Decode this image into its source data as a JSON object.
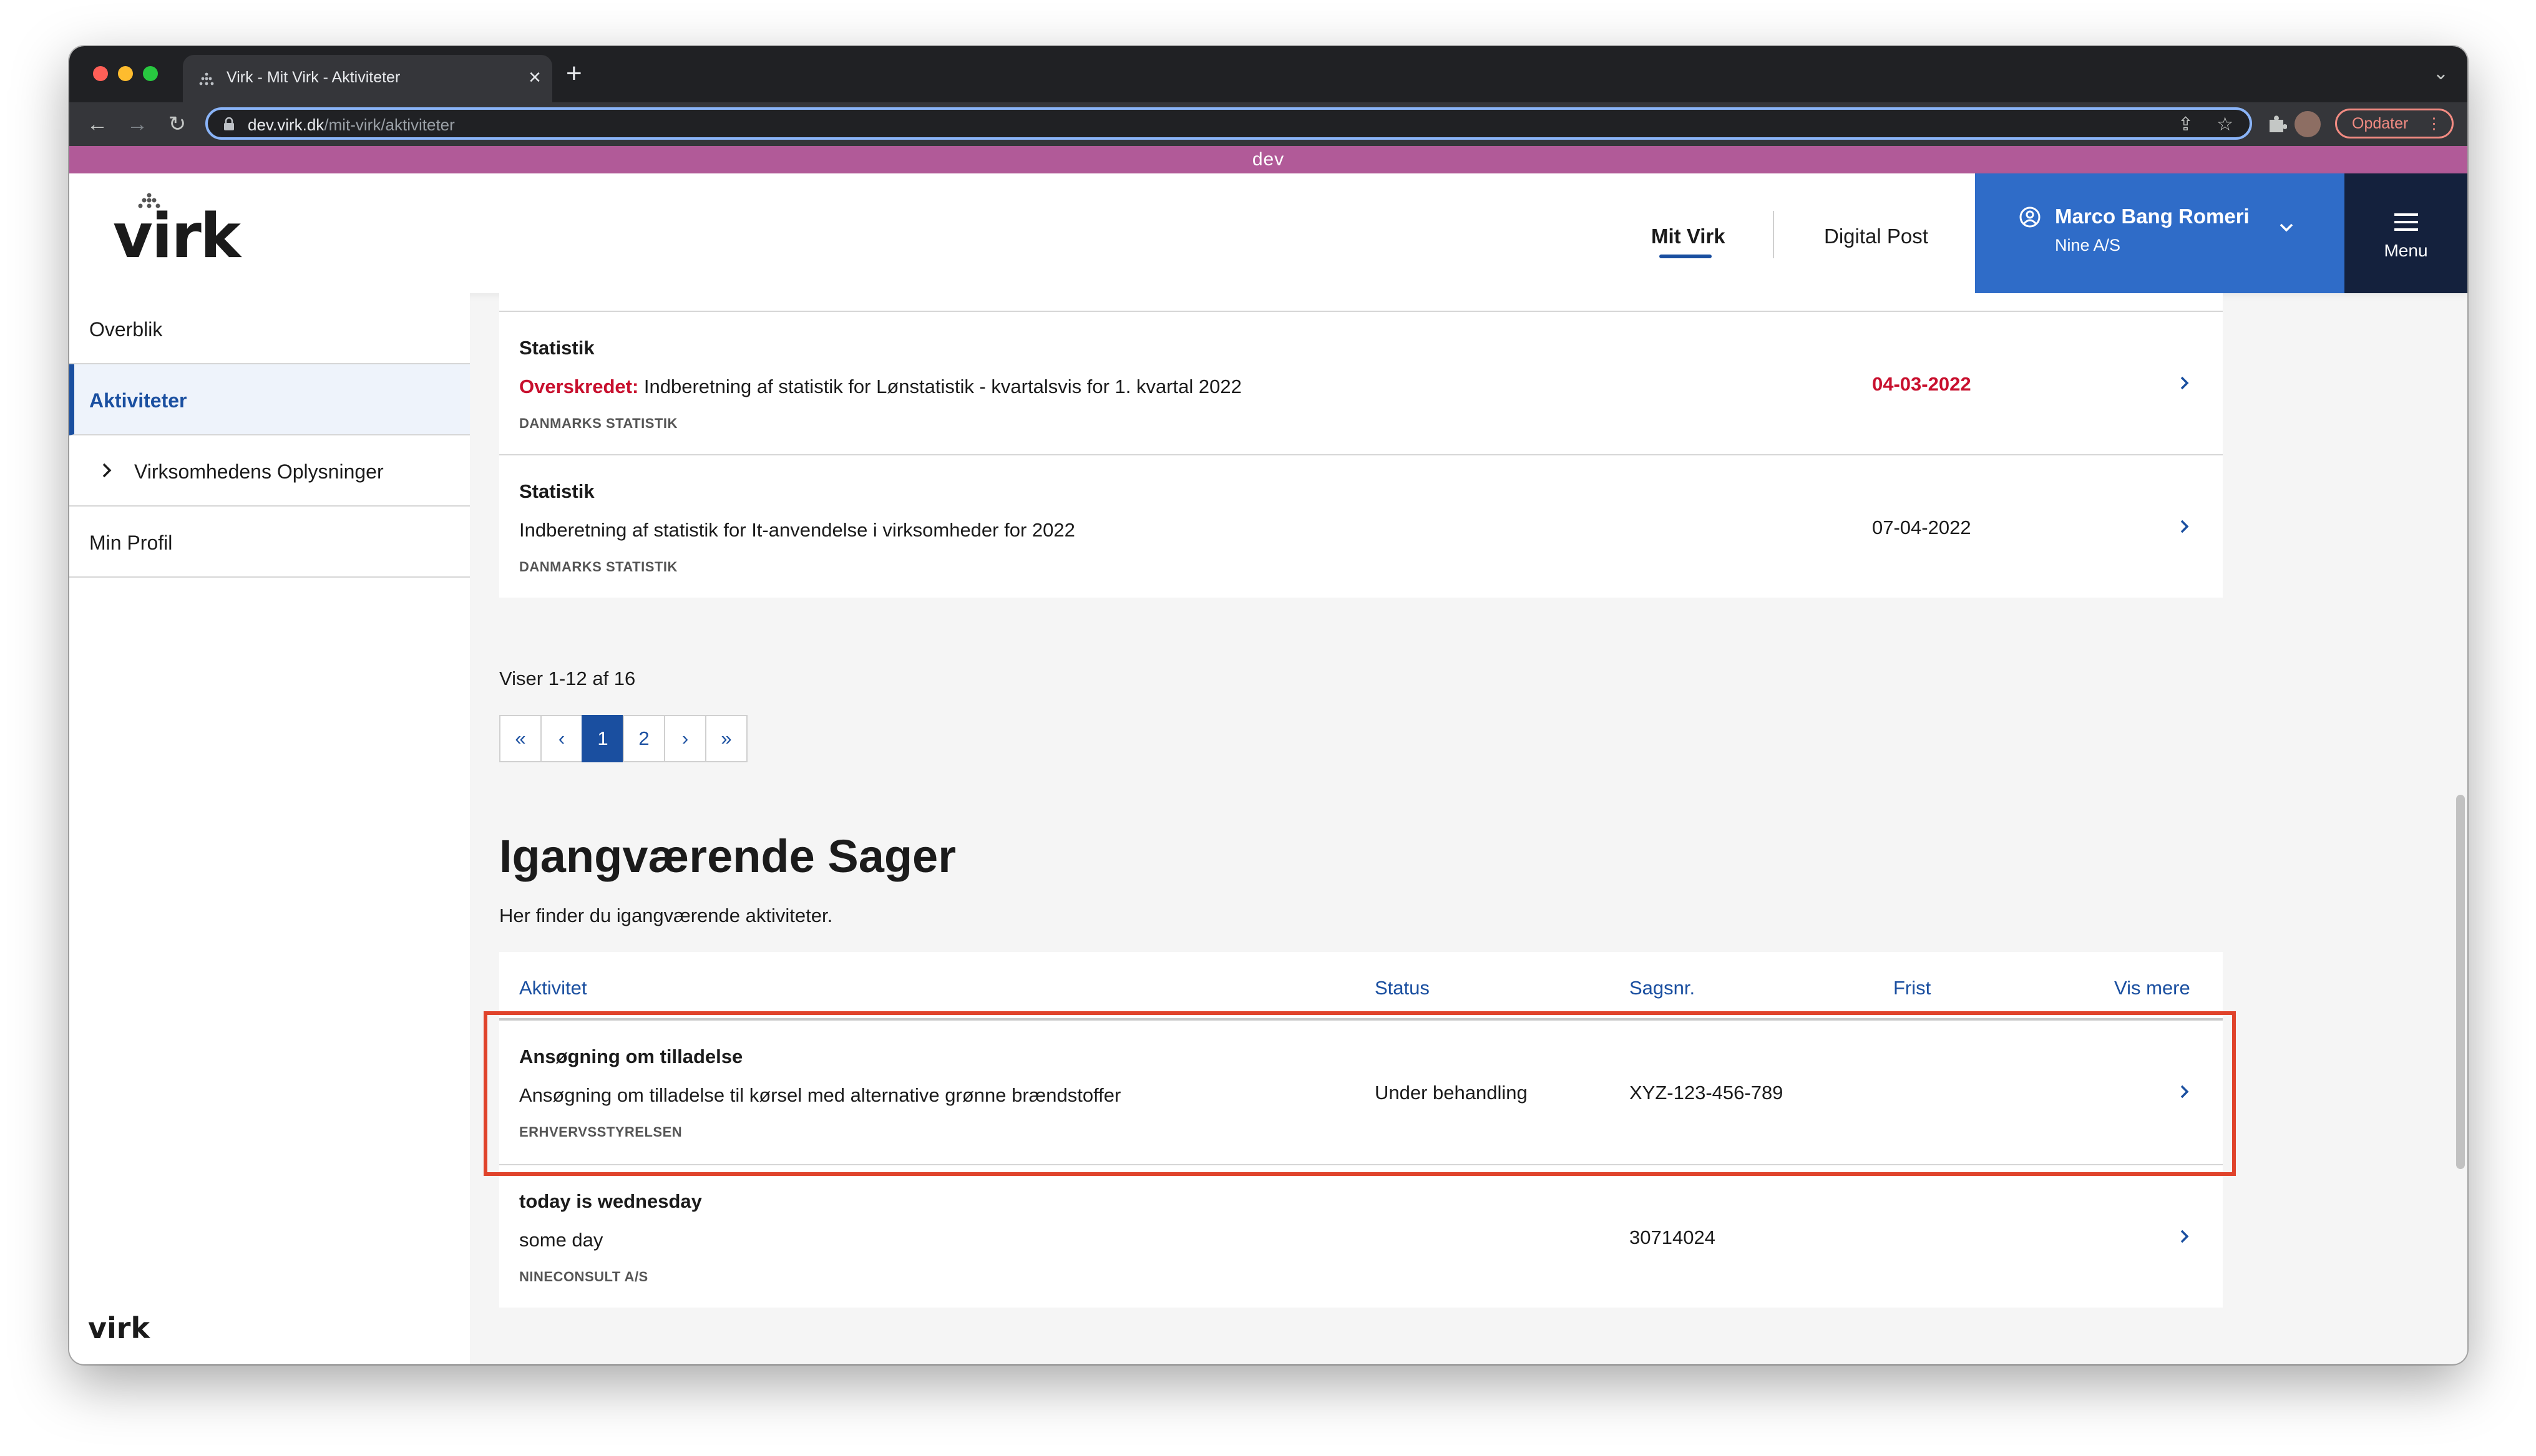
{
  "browser": {
    "tab_title": "Virk - Mit Virk - Aktiviteter",
    "tab_close": "×",
    "new_tab": "+",
    "url_host": "dev.virk.dk",
    "url_path": "/mit-virk/aktiviteter",
    "update_label": "Opdater",
    "update_menu": "⋮",
    "tabstrip_chevron": "⌄",
    "nav_back": "←",
    "nav_forward": "→",
    "nav_reload": "↻",
    "share_icon": "⇪",
    "star_icon": "☆",
    "colors": {
      "close": "#ff5f57",
      "minimize": "#febc2e",
      "zoom": "#28c840"
    }
  },
  "env_banner": "dev",
  "header": {
    "logo": "virk",
    "nav": [
      {
        "label": "Mit Virk",
        "active": true
      },
      {
        "label": "Digital Post",
        "active": false
      }
    ],
    "user": {
      "name": "Marco Bang Romeri",
      "company": "Nine A/S"
    },
    "menu_label": "Menu"
  },
  "sidebar": {
    "items": [
      {
        "label": "Overblik"
      },
      {
        "label": "Aktiviteter",
        "active": true
      },
      {
        "label": "Virksomhedens Oplysninger",
        "expandable": true
      },
      {
        "label": "Min Profil"
      }
    ],
    "footer_logo": "virk"
  },
  "activities": {
    "rows": [
      {
        "category": "Statistik",
        "overdue_label": "Overskredet:",
        "description": " Indberetning af statistik for Lønstatistik - kvartalsvis for 1. kvartal 2022",
        "authority": "DANMARKS STATISTIK",
        "date": "04-03-2022"
      },
      {
        "category": "Statistik",
        "description": "Indberetning af statistik for It-anvendelse i virksomheder for 2022",
        "authority": "DANMARKS STATISTIK",
        "date": "07-04-2022"
      }
    ],
    "count_text": "Viser 1-12 af 16",
    "pagination": [
      "«",
      "‹",
      "1",
      "2",
      "›",
      "»"
    ],
    "current_page": "1"
  },
  "cases": {
    "title": "Igangværende Sager",
    "subtitle": "Her finder du igangværende aktiviteter.",
    "columns": [
      "Aktivitet",
      "Status",
      "Sagsnr.",
      "Frist",
      "Vis mere"
    ],
    "rows": [
      {
        "title": "Ansøgning om tilladelse",
        "description": "Ansøgning om tilladelse til kørsel med alternative grønne brændstoffer",
        "authority": "ERHVERVSSTYRELSEN",
        "status": "Under behandling",
        "case_no": "XYZ-123-456-789",
        "deadline": "",
        "highlighted": true
      },
      {
        "title": "today is wednesday",
        "description": "some day",
        "authority": "NINECONSULT A/S",
        "status": "",
        "case_no": "30714024",
        "deadline": ""
      }
    ]
  }
}
